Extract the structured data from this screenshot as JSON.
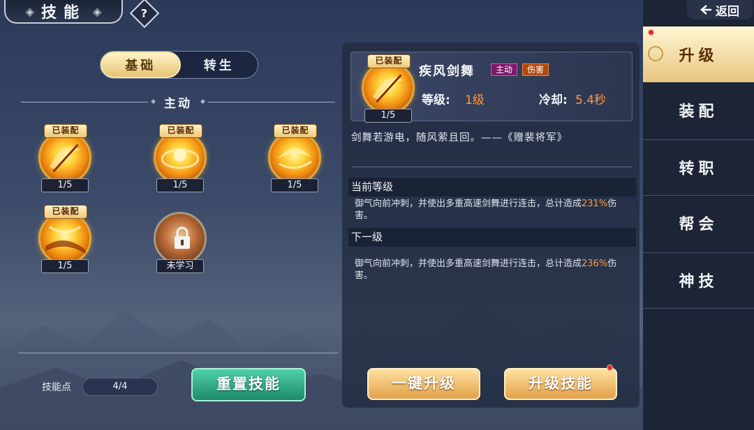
{
  "header": {
    "title": "技能",
    "help_icon": "?"
  },
  "tabs": [
    {
      "label": "基础",
      "active": true
    },
    {
      "label": "转生",
      "active": false
    }
  ],
  "section": {
    "title": "主动"
  },
  "skills": [
    {
      "equip": "已装配",
      "level": "1/5"
    },
    {
      "equip": "已装配",
      "level": "1/5"
    },
    {
      "equip": "已装配",
      "level": "1/5"
    },
    {
      "equip": "已装配",
      "level": "1/5"
    },
    {
      "equip": "",
      "level": "未学习"
    }
  ],
  "footer": {
    "points_label": "技能点",
    "points_value": "4/4",
    "reset_button": "重置技能"
  },
  "detail": {
    "equip": "已装配",
    "level_badge": "1/5",
    "name": "疾风剑舞",
    "tag_active": "主动",
    "tag_damage": "伤害",
    "level_label": "等级:",
    "level_value": "1级",
    "cooldown_label": "冷却:",
    "cooldown_value": "5.4秒",
    "flavor": "剑舞若游电，随风萦且回。——《赠裴将军》",
    "current_header": "当前等级",
    "current_desc_a": "御气向前冲刺，并使出多重高速剑舞进行连击，总计造成",
    "current_desc_pct": "231%",
    "current_desc_b": "伤害。",
    "next_header": "下一级",
    "next_desc_a": "御气向前冲刺，并使出多重高速剑舞进行连击，总计造成",
    "next_desc_pct": "236%",
    "next_desc_b": "伤害。"
  },
  "actions": {
    "one_key": "一键升级",
    "upgrade": "升级技能"
  },
  "sidebar": {
    "back": "返回",
    "items": [
      {
        "label": "升级",
        "active": true
      },
      {
        "label": "装配",
        "active": false
      },
      {
        "label": "转职",
        "active": false
      },
      {
        "label": "帮会",
        "active": false
      },
      {
        "label": "神技",
        "active": false
      }
    ]
  },
  "colors": {
    "accent_gold": "#e8c680",
    "highlight_orange": "#ff9a3c",
    "reset_green": "#2fae88",
    "red_dot": "#e32a2a"
  }
}
